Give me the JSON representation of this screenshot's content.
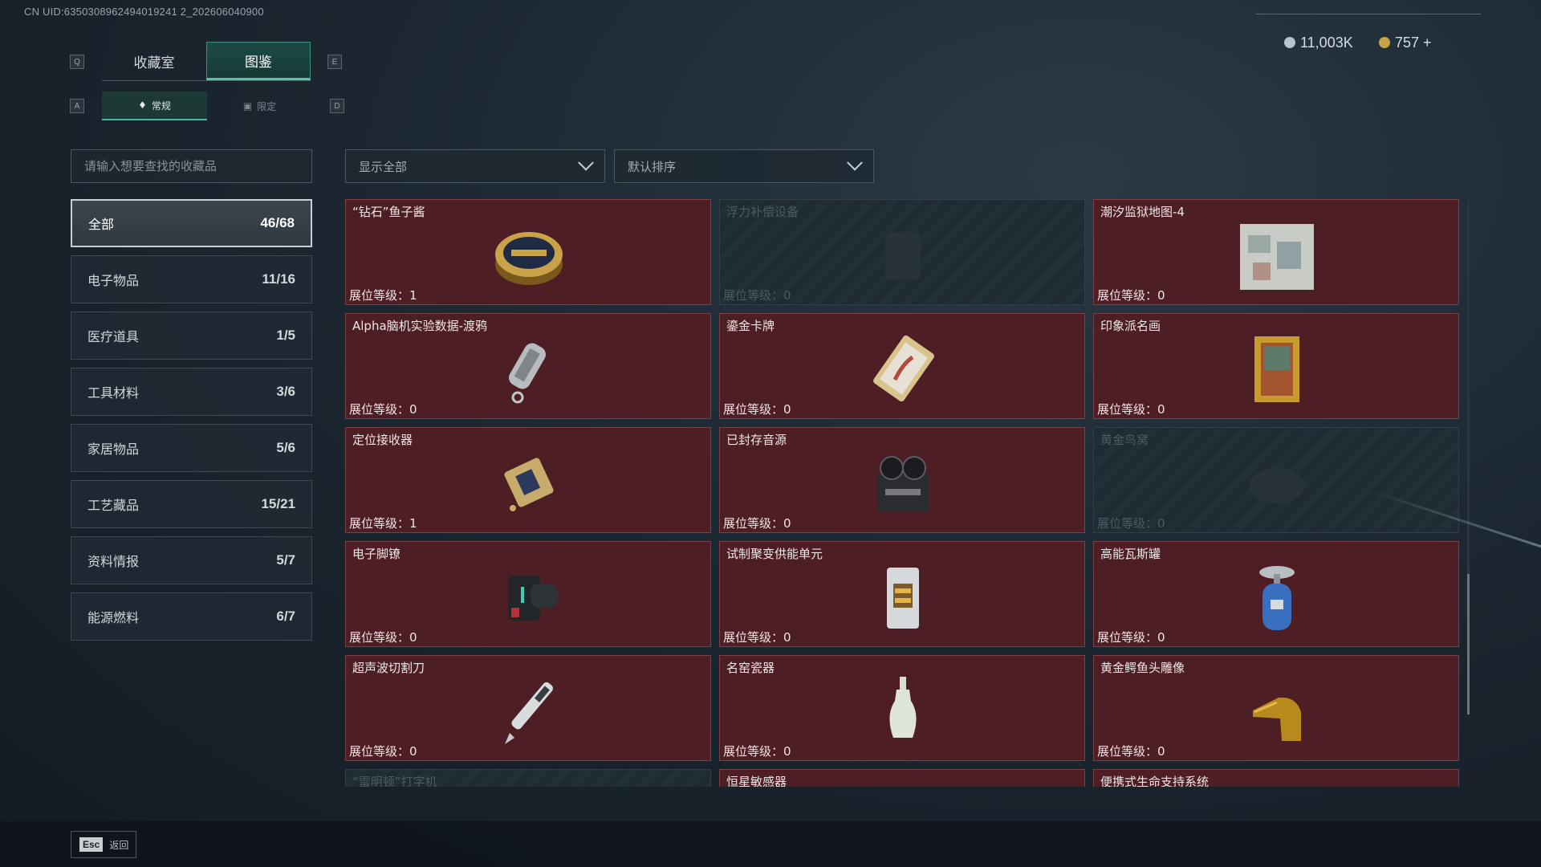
{
  "uid": "CN UID:6350308962494019241 2_202606040900",
  "tabs": {
    "q_key": "Q",
    "e_key": "E",
    "items": [
      {
        "label": "收藏室"
      },
      {
        "label": "图鉴"
      }
    ]
  },
  "subtabs": {
    "a_key": "A",
    "d_key": "D",
    "items": [
      {
        "label": "常规"
      },
      {
        "label": "限定"
      }
    ]
  },
  "currency": [
    {
      "value": "11,003K",
      "color": "#b9c3cc"
    },
    {
      "value": "757 +",
      "color": "#c9a24a"
    }
  ],
  "search": {
    "placeholder": "请输入想要查找的收藏品"
  },
  "filters": {
    "show": "显示全部",
    "sort": "默认排序"
  },
  "categories": [
    {
      "label": "全部",
      "count": "46/68"
    },
    {
      "label": "电子物品",
      "count": "11/16"
    },
    {
      "label": "医疗道具",
      "count": "1/5"
    },
    {
      "label": "工具材料",
      "count": "3/6"
    },
    {
      "label": "家居物品",
      "count": "5/6"
    },
    {
      "label": "工艺藏品",
      "count": "15/21"
    },
    {
      "label": "资料情报",
      "count": "5/7"
    },
    {
      "label": "能源燃料",
      "count": "6/7"
    }
  ],
  "items": [
    {
      "name": "“钻石”鱼子酱",
      "level": "展位等级：1",
      "icon": "caviar-tin-icon"
    },
    {
      "name": "浮力补偿设备",
      "level": "展位等级：0",
      "icon": "bcd-vest-icon"
    },
    {
      "name": "潮汐监狱地图-4",
      "level": "展位等级：0",
      "icon": "map-icon"
    },
    {
      "name": "Alpha脑机实验数据-渡鸦",
      "level": "展位等级：0",
      "icon": "data-drive-icon"
    },
    {
      "name": "鎏金卡牌",
      "level": "展位等级：0",
      "icon": "gilded-card-icon"
    },
    {
      "name": "印象派名画",
      "level": "展位等级：0",
      "icon": "painting-icon"
    },
    {
      "name": "定位接收器",
      "level": "展位等级：1",
      "icon": "receiver-icon"
    },
    {
      "name": "已封存音源",
      "level": "展位等级：0",
      "icon": "tape-recorder-icon"
    },
    {
      "name": "黄金鸟窝",
      "level": "展位等级：0",
      "icon": "bird-nest-icon"
    },
    {
      "name": "电子脚镣",
      "level": "展位等级：0",
      "icon": "ankle-monitor-icon"
    },
    {
      "name": "试制聚变供能单元",
      "level": "展位等级：0",
      "icon": "fusion-cell-icon"
    },
    {
      "name": "高能瓦斯罐",
      "level": "展位等级：0",
      "icon": "gas-canister-icon"
    },
    {
      "name": "超声波切割刀",
      "level": "展位等级：0",
      "icon": "ultrasonic-cutter-icon"
    },
    {
      "name": "名窑瓷器",
      "level": "展位等级：0",
      "icon": "porcelain-vase-icon"
    },
    {
      "name": "黄金鳄鱼头雕像",
      "level": "展位等级：0",
      "icon": "croc-statue-icon"
    },
    {
      "name": "“雷明顿”打字机",
      "level": "",
      "icon": "typewriter-icon"
    },
    {
      "name": "恒星敏感器",
      "level": "",
      "icon": "star-sensor-icon"
    },
    {
      "name": "便携式生命支持系统",
      "level": "",
      "icon": "life-support-icon"
    }
  ],
  "back": {
    "key": "Esc",
    "label": "返回"
  }
}
